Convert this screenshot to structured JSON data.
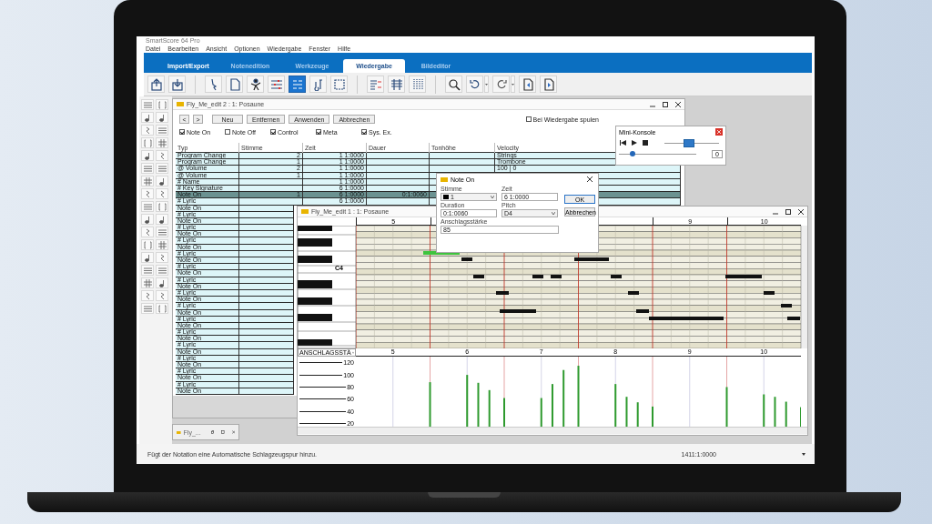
{
  "app_title": "SmartScore 64 Pro",
  "menu": [
    "Datei",
    "Bearbeiten",
    "Ansicht",
    "Optionen",
    "Wiedergabe",
    "Fenster",
    "Hilfe"
  ],
  "ribbon_tabs": [
    {
      "label": "Import/Export",
      "selected": false
    },
    {
      "label": "Notenedition",
      "selected": false
    },
    {
      "label": "Werkzeuge",
      "selected": false
    },
    {
      "label": "Wiedergabe",
      "selected": true
    },
    {
      "label": "Bildeditor",
      "selected": false
    }
  ],
  "toolbar_buttons": [
    {
      "selected": false
    },
    {
      "selected": false
    },
    {
      "selected": false
    },
    {
      "selected": false
    },
    {
      "selected": false
    },
    {
      "selected": false
    },
    {
      "selected": true
    },
    {
      "selected": false
    },
    {
      "selected": false
    },
    {
      "selected": false
    },
    {
      "selected": false
    },
    {
      "selected": false
    },
    {
      "selected": false
    },
    {
      "selected": false
    },
    {
      "selected": false
    },
    {
      "selected": false
    },
    {
      "selected": false
    }
  ],
  "event_list": {
    "title": "Fly_Me_edit 2 : 1: Posaune",
    "nav_buttons": [
      "<",
      ">"
    ],
    "buttons": [
      "Neu",
      "Entfernen",
      "Anwenden",
      "Abbrechen"
    ],
    "follow_playback": {
      "label": "Bei Wiedergabe spulen",
      "checked": false
    },
    "filters": [
      {
        "label": "Note On",
        "checked": true
      },
      {
        "label": "Note Off",
        "checked": false
      },
      {
        "label": "Control",
        "checked": true
      },
      {
        "label": "Meta",
        "checked": true
      },
      {
        "label": "Sys. Ex.",
        "checked": true
      }
    ],
    "columns": [
      "Typ",
      "Stimme",
      "Zeit",
      "Dauer",
      "Tonhöhe",
      "Velocity"
    ],
    "rows": [
      {
        "typ": "Program Change",
        "stimme": "2",
        "zeit": "1 1:0000",
        "velocity": "Strings",
        "selected": false
      },
      {
        "typ": "Program Change",
        "stimme": "1",
        "zeit": "1 1:0000",
        "velocity": "Trombone",
        "selected": false
      },
      {
        "typ": "@ Volume",
        "stimme": "2",
        "zeit": "1 1:0000",
        "velocity": "100 | 0",
        "selected": false
      },
      {
        "typ": "@ Volume",
        "stimme": "1",
        "zeit": "1 1:0000",
        "selected": false
      },
      {
        "typ": "# Name",
        "zeit": "1 1:0000",
        "selected": false
      },
      {
        "typ": "# Key Signature",
        "zeit": "6 1:0000",
        "selected": false
      },
      {
        "typ": "Note On",
        "stimme": "1",
        "zeit": "6 1:0000",
        "dauer": "0:1:0060",
        "selected": true
      },
      {
        "typ": "# Lyric",
        "zeit": "6 1:0000",
        "selected": false
      },
      {
        "typ": "Note On",
        "selected": false
      },
      {
        "typ": "# Lyric",
        "selected": false
      },
      {
        "typ": "Note On",
        "selected": false
      },
      {
        "typ": "# Lyric",
        "selected": false
      },
      {
        "typ": "Note On",
        "selected": false
      },
      {
        "typ": "# Lyric",
        "selected": false
      },
      {
        "typ": "Note On",
        "selected": false
      },
      {
        "typ": "# Lyric",
        "selected": false
      },
      {
        "typ": "Note On",
        "selected": false
      },
      {
        "typ": "# Lyric",
        "selected": false
      },
      {
        "typ": "Note On",
        "selected": false
      },
      {
        "typ": "# Lyric",
        "selected": false
      },
      {
        "typ": "Note On",
        "selected": false
      },
      {
        "typ": "# Lyric",
        "selected": false
      },
      {
        "typ": "Note On",
        "selected": false
      },
      {
        "typ": "# Lyric",
        "selected": false
      },
      {
        "typ": "Note On",
        "selected": false
      },
      {
        "typ": "# Lyric",
        "selected": false
      },
      {
        "typ": "Note On",
        "selected": false
      },
      {
        "typ": "# Lyric",
        "selected": false
      },
      {
        "typ": "Note On",
        "selected": false
      },
      {
        "typ": "# Lyric",
        "selected": false
      },
      {
        "typ": "Note On",
        "selected": false
      },
      {
        "typ": "# Lyric",
        "selected": false
      },
      {
        "typ": "Note On",
        "selected": false
      },
      {
        "typ": "# Lyric",
        "selected": false
      },
      {
        "typ": "Note On",
        "selected": false
      },
      {
        "typ": "# Lyric",
        "selected": false
      },
      {
        "typ": "Note On",
        "selected": false
      }
    ]
  },
  "minimized_window": {
    "title": "Fly_..."
  },
  "piano_roll": {
    "title": "Fly_Me_edit 1 : 1: Posaune",
    "ruler": [
      "5",
      "9",
      "10"
    ],
    "key_label": "C4",
    "lane_selector": "ANSCHLAGSSTÄ",
    "chart_data": {
      "type": "bar",
      "x": [
        6,
        6.5,
        6.65,
        6.8,
        7,
        7.5,
        7.65,
        7.8,
        8,
        8.5,
        8.65,
        8.8,
        9,
        10,
        10.5,
        10.65,
        10.8,
        11
      ],
      "values": [
        88,
        100,
        87,
        75,
        62,
        62,
        85,
        108,
        115,
        85,
        64,
        55,
        48,
        80,
        68,
        64,
        56,
        47
      ],
      "xlim": [
        5,
        11
      ],
      "ylim": [
        15,
        130
      ],
      "grid": true,
      "ref_lines": [
        {
          "axis": "x",
          "value": 6,
          "color": "#d46a6a"
        },
        {
          "axis": "x",
          "value": 7,
          "color": "#d46a6a"
        },
        {
          "axis": "x",
          "value": 8,
          "color": "#d46a6a"
        },
        {
          "axis": "x",
          "value": 9,
          "color": "#d46a6a"
        },
        {
          "axis": "x",
          "value": 10,
          "color": "#d46a6a"
        }
      ],
      "yticks": [
        20,
        40,
        60,
        80,
        100,
        120
      ],
      "xticks": [
        {
          "value": 5.5,
          "label": "5"
        },
        {
          "value": 6.5,
          "label": "6"
        },
        {
          "value": 7.5,
          "label": "7"
        },
        {
          "value": 8.5,
          "label": "8"
        },
        {
          "value": 9.5,
          "label": "9"
        },
        {
          "value": 10.5,
          "label": "10"
        }
      ]
    }
  },
  "note_dialog": {
    "title": "Note On",
    "voice": {
      "label": "Stimme",
      "value": "1",
      "color": "#000000"
    },
    "time": {
      "label": "Zeit",
      "value": "6 1:0000"
    },
    "duration": {
      "label": "Duration",
      "value": "0:1:0060"
    },
    "pitch": {
      "label": "Pitch",
      "value": "D4"
    },
    "velocity": {
      "label": "Anschlagsstärke",
      "value": "85"
    },
    "buttons": [
      "OK",
      "Abbrechen"
    ]
  },
  "mini_console": {
    "title": "Mini-Konsole",
    "tempo": {
      "level": 0.45
    },
    "volume": {
      "level": 0.18
    },
    "value": "0"
  },
  "status_bar": {
    "message": "Fügt der Notation eine Automatische Schlagzeugspur hinzu.",
    "position": "1411:1:0000"
  }
}
